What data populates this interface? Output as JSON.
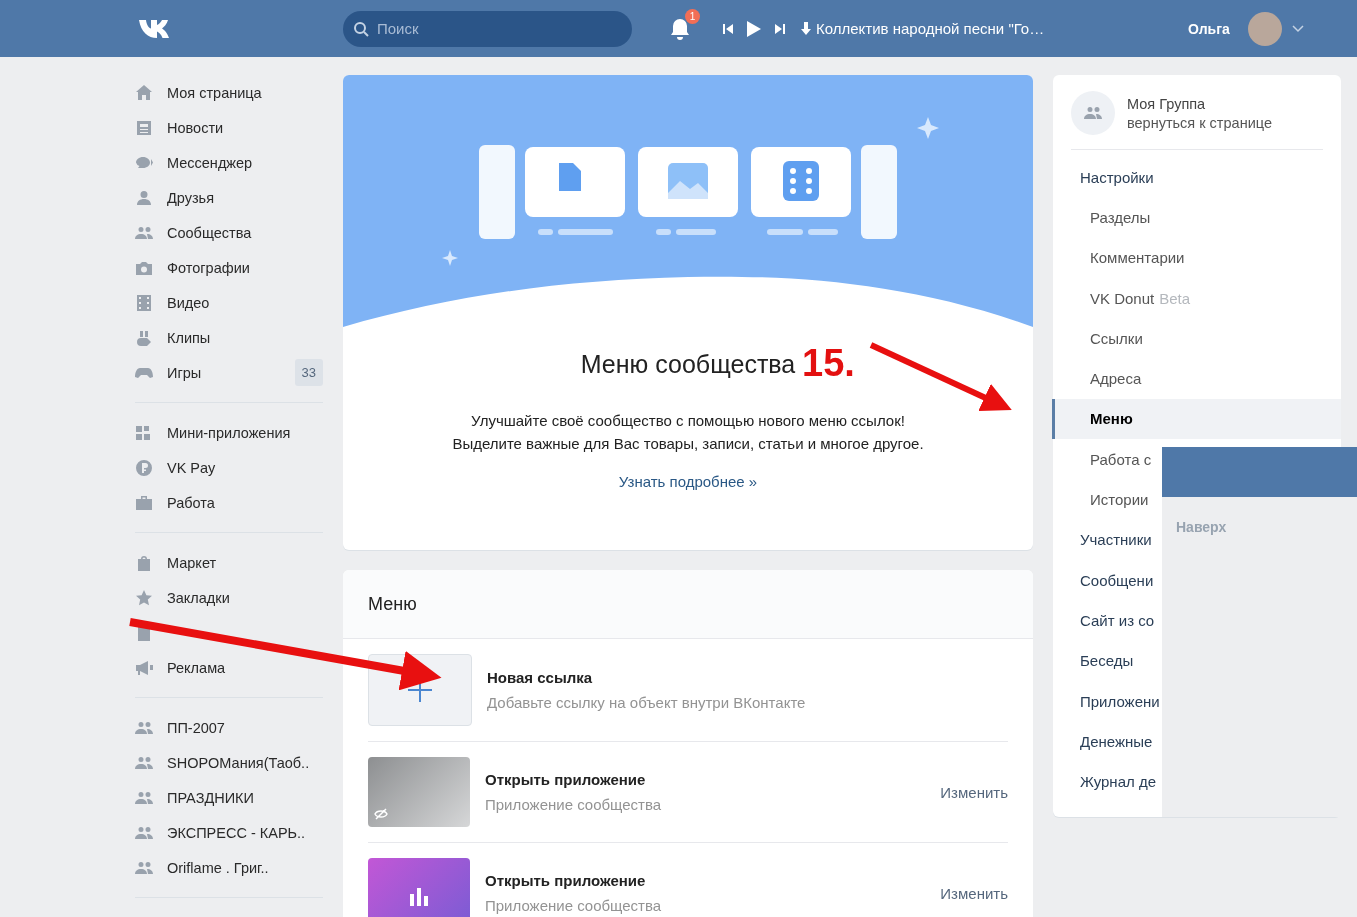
{
  "header": {
    "search": {
      "placeholder": "Поиск"
    },
    "notifications": {
      "count": "1"
    },
    "player": {
      "track": "Коллектив народной песни \"Го…"
    },
    "user": {
      "name": "Ольга"
    }
  },
  "nav": [
    {
      "items": [
        {
          "label": "Моя страница",
          "kind": "page"
        },
        {
          "label": "Новости",
          "kind": "page"
        },
        {
          "label": "Мессенджер",
          "kind": "page"
        },
        {
          "label": "Друзья",
          "kind": "page"
        },
        {
          "label": "Сообщества",
          "kind": "page"
        },
        {
          "label": "Фотографии",
          "kind": "page"
        },
        {
          "label": "Видео",
          "kind": "page"
        },
        {
          "label": "Клипы",
          "kind": "page"
        },
        {
          "label": "Игры",
          "kind": "page",
          "count": "33"
        }
      ]
    },
    {
      "items": [
        {
          "label": "Мини-приложения",
          "kind": "page"
        },
        {
          "label": "VK Pay",
          "kind": "page"
        },
        {
          "label": "Работа",
          "kind": "page"
        }
      ]
    },
    {
      "items": [
        {
          "label": "Маркет",
          "kind": "page"
        },
        {
          "label": "Закладки",
          "kind": "page"
        },
        {
          "kind": "page"
        },
        {
          "label": "Реклама",
          "kind": "page"
        }
      ]
    },
    {
      "items": [
        {
          "label": "ПП-2007",
          "kind": "community"
        },
        {
          "label": "SHOPOМания(Таоб..",
          "kind": "community"
        },
        {
          "label": "ПРАЗДНИКИ",
          "kind": "community"
        },
        {
          "label": "ЭКСПРЕСС - КАРЬ..",
          "kind": "community"
        },
        {
          "label": "Oriflame . Григ..",
          "kind": "community"
        }
      ]
    }
  ],
  "promo": {
    "title": "Меню сообщества",
    "description": [
      "Улучшайте своё сообщество с помощью нового меню ссылок!",
      "Выделите важные для Вас товары, записи, статьи и многое другое."
    ],
    "link": "Узнать подробнее »"
  },
  "menu": {
    "title": "Меню",
    "rows": [
      {
        "kind": "add",
        "title": "Новая ссылка",
        "subtitle": "Добавьте ссылку на объект внутри ВКонтакте"
      },
      {
        "kind": "photo",
        "title": "Открыть приложение",
        "subtitle": "Приложение сообщества",
        "action": "Изменить"
      },
      {
        "kind": "app",
        "title": "Открыть приложение",
        "subtitle": "Приложение сообщества",
        "action": "Изменить"
      }
    ]
  },
  "group": {
    "name": "Моя Группа",
    "back": "вернуться к странице"
  },
  "settings": [
    {
      "label": "Настройки",
      "selected": false,
      "children": [
        {
          "label": "Разделы",
          "selected": false
        },
        {
          "label": "Комментарии",
          "selected": false
        },
        {
          "label": "VK Donut",
          "badge": "Beta",
          "selected": false
        },
        {
          "label": "Ссылки",
          "selected": false
        },
        {
          "label": "Адреса",
          "selected": false
        },
        {
          "label": "Меню",
          "selected": true
        },
        {
          "label": "Работа с",
          "selected": false
        },
        {
          "label": "Истории",
          "selected": false
        }
      ]
    },
    {
      "label": "Участники",
      "selected": false
    },
    {
      "label": "Сообщени",
      "selected": false
    },
    {
      "label": "Сайт из со",
      "selected": false
    },
    {
      "label": "Беседы",
      "selected": false
    },
    {
      "label": "Приложени",
      "selected": false
    },
    {
      "label": "Денежные",
      "selected": false
    },
    {
      "label": "Журнал де",
      "selected": false
    }
  ],
  "overlay": {
    "link": "Наверх"
  },
  "annotation": {
    "label": "15."
  }
}
